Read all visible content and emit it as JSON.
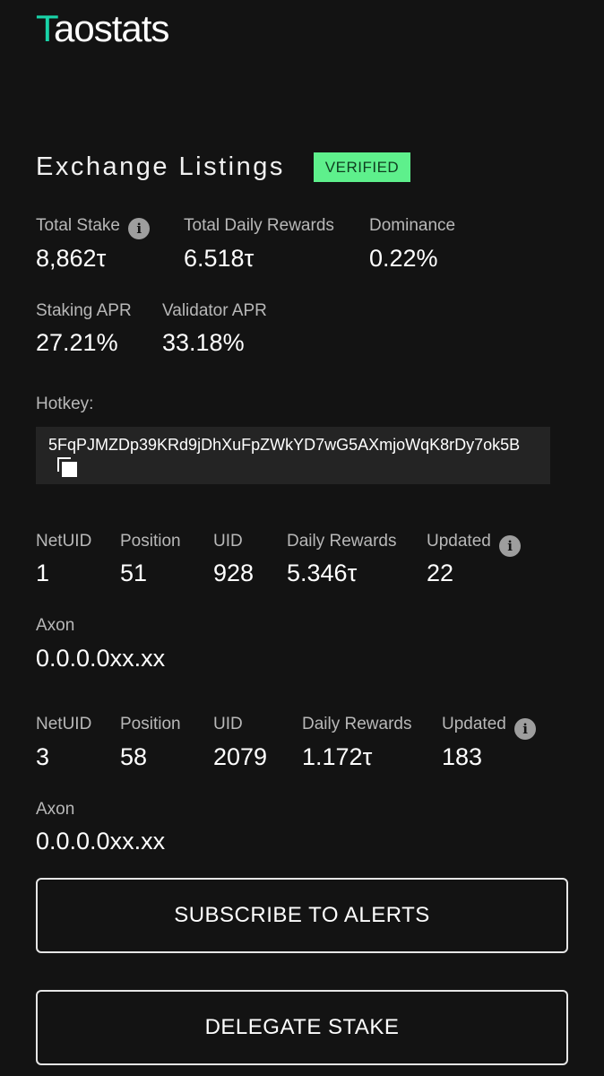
{
  "logo": {
    "first_letter": "T",
    "rest": "aostats"
  },
  "validator": {
    "name": "Exchange Listings",
    "badge": "VERIFIED"
  },
  "stats": {
    "total_stake": {
      "label": "Total Stake",
      "value": "8,862τ"
    },
    "total_daily_rewards": {
      "label": "Total Daily Rewards",
      "value": "6.518τ"
    },
    "dominance": {
      "label": "Dominance",
      "value": "0.22%"
    },
    "staking_apr": {
      "label": "Staking APR",
      "value": "27.21%"
    },
    "validator_apr": {
      "label": "Validator APR",
      "value": "33.18%"
    }
  },
  "hotkey": {
    "label": "Hotkey:",
    "value": "5FqPJMZDp39KRd9jDhXuFpZWkYD7wG5AXmjoWqK8rDy7ok5B"
  },
  "icons": {
    "info": "info-icon",
    "copy": "copy-icon"
  },
  "colors": {
    "background": "#131313",
    "badge": "#5ef08c",
    "logo_accent": "#19d3a8"
  },
  "subnets": [
    {
      "netuid_label": "NetUID",
      "netuid": "1",
      "position_label": "Position",
      "position": "51",
      "uid_label": "UID",
      "uid": "928",
      "daily_rewards_label": "Daily Rewards",
      "daily_rewards": "5.346τ",
      "updated_label": "Updated",
      "updated": "22",
      "axon_label": "Axon",
      "axon": "0.0.0.0xx.xx"
    },
    {
      "netuid_label": "NetUID",
      "netuid": "3",
      "position_label": "Position",
      "position": "58",
      "uid_label": "UID",
      "uid": "2079",
      "daily_rewards_label": "Daily Rewards",
      "daily_rewards": "1.172τ",
      "updated_label": "Updated",
      "updated": "183",
      "axon_label": "Axon",
      "axon": "0.0.0.0xx.xx"
    }
  ],
  "buttons": {
    "subscribe": "SUBSCRIBE TO ALERTS",
    "delegate": "DELEGATE STAKE"
  }
}
